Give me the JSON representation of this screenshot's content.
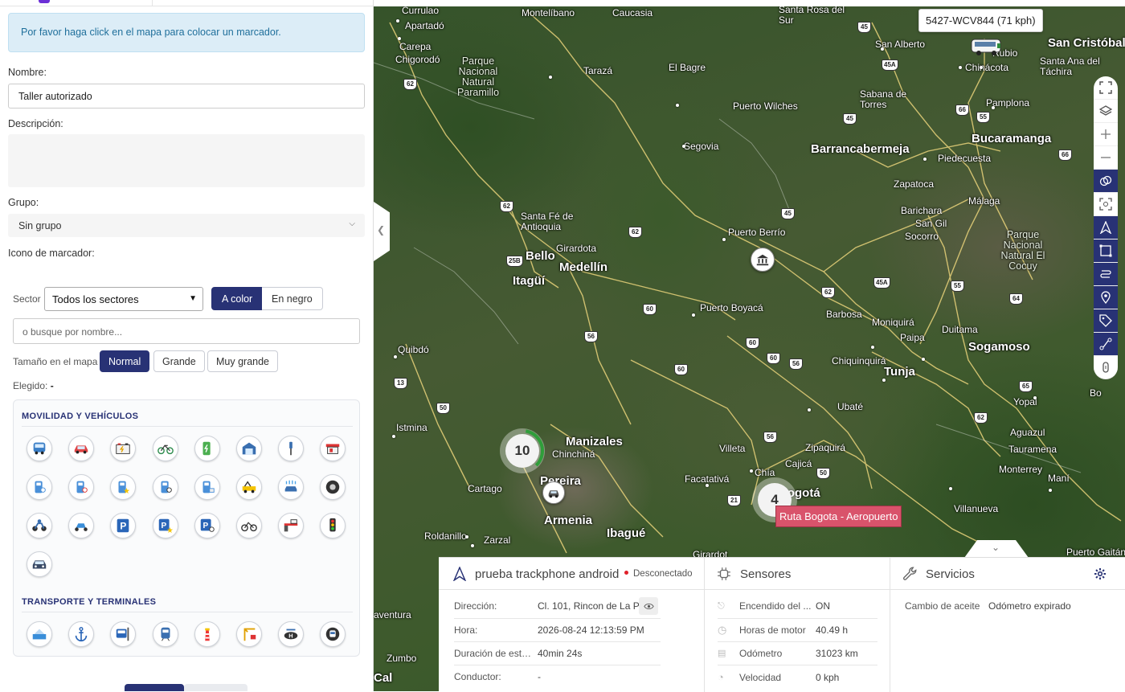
{
  "form": {
    "alert": "Por favor haga click en el mapa para colocar un marcador.",
    "name_label": "Nombre:",
    "name_value": "Taller autorizado",
    "desc_label": "Descripción:",
    "group_label": "Grupo:",
    "group_value": "Sin grupo",
    "icon_label": "Icono de marcador:",
    "sector_label": "Sector",
    "sector_value": "Todos los sectores",
    "color_btn": "A color",
    "black_btn": "En negro",
    "search_placeholder": "o busque por nombre...",
    "size_label": "Tamaño en el mapa",
    "size_options": [
      "Normal",
      "Grande",
      "Muy grande"
    ],
    "chosen_label": "Elegido:",
    "chosen_value": "-"
  },
  "icon_categories": [
    {
      "title": "MOVILIDAD Y VEHÍCULOS",
      "icons": [
        "bus-icon",
        "car-icon",
        "battery-icon",
        "bicycle-icon",
        "ev-charger-icon",
        "garage-icon",
        "screwdriver-icon",
        "gas-station-icon",
        "fuel-pump-icon",
        "fuel-pump-2-icon",
        "fuel-pump-star-icon",
        "fuel-pump-3-icon",
        "fuel-pump-4-icon",
        "tow-truck-icon",
        "car-wash-icon",
        "tire-icon",
        "motorcycle-icon",
        "scooter-icon",
        "parking-icon",
        "parking-star-icon",
        "parking-search-icon",
        "bicycle-2-icon",
        "toll-barrier-icon",
        "traffic-light-icon",
        "car-front-icon"
      ]
    },
    {
      "title": "TRANSPORTE Y TERMINALES",
      "icons": [
        "airport-icon",
        "anchor-icon",
        "bus-stop-icon",
        "train-icon",
        "lighthouse-icon",
        "port-crane-icon",
        "helipad-icon",
        "metro-icon"
      ]
    }
  ],
  "map": {
    "vehicle_tooltip": "5427-WCV844 (71 kph)",
    "route_tag": "Ruta Bogota - Aeropuerto",
    "clusters": [
      {
        "count": "10"
      },
      {
        "count": "4"
      }
    ],
    "places": [
      {
        "name": "Currulao"
      },
      {
        "name": "Apartadó"
      },
      {
        "name": "Carepa"
      },
      {
        "name": "Chigorodó"
      },
      {
        "name": "Montelíbano"
      },
      {
        "name": "Caucasia"
      },
      {
        "name": "Santa Rosa del Sur"
      },
      {
        "name": "San Alberto"
      },
      {
        "name": "San Cristóbal"
      },
      {
        "name": "Santa Ana del Táchira"
      },
      {
        "name": "Chinácota"
      },
      {
        "name": "Rubio"
      },
      {
        "name": "Tarazá"
      },
      {
        "name": "El Bagre"
      },
      {
        "name": "Puerto Wilches"
      },
      {
        "name": "Sabana de Torres"
      },
      {
        "name": "Pamplona"
      },
      {
        "name": "Bucaramanga"
      },
      {
        "name": "Piedecuesta"
      },
      {
        "name": "Segovia"
      },
      {
        "name": "Barrancabermeja"
      },
      {
        "name": "Zapatoca"
      },
      {
        "name": "Málaga"
      },
      {
        "name": "Barichara"
      },
      {
        "name": "San Gil"
      },
      {
        "name": "Socorro"
      },
      {
        "name": "Santa Fé de Antioquia"
      },
      {
        "name": "Girardota"
      },
      {
        "name": "Bello"
      },
      {
        "name": "Medellín"
      },
      {
        "name": "Itagüí"
      },
      {
        "name": "Puerto Berrío"
      },
      {
        "name": "Puerto Boyacá"
      },
      {
        "name": "Barbosa"
      },
      {
        "name": "Moniquirá"
      },
      {
        "name": "Paipa"
      },
      {
        "name": "Duitama"
      },
      {
        "name": "Sogamoso"
      },
      {
        "name": "Quibdó"
      },
      {
        "name": "Chiquinquirá"
      },
      {
        "name": "Tunja"
      },
      {
        "name": "Ubaté"
      },
      {
        "name": "Yopal"
      },
      {
        "name": "Istmina"
      },
      {
        "name": "Manizales"
      },
      {
        "name": "Chinchiná"
      },
      {
        "name": "Villeta"
      },
      {
        "name": "Zipaquirá"
      },
      {
        "name": "Cajicá"
      },
      {
        "name": "Chía"
      },
      {
        "name": "Aguazul"
      },
      {
        "name": "Tauramena"
      },
      {
        "name": "Monterrey"
      },
      {
        "name": "Pereira"
      },
      {
        "name": "Cartago"
      },
      {
        "name": "Facatativá"
      },
      {
        "name": "Bogotá"
      },
      {
        "name": "Villanueva"
      },
      {
        "name": "Maní"
      },
      {
        "name": "Armenia"
      },
      {
        "name": "Ibagué"
      },
      {
        "name": "Roldanillo"
      },
      {
        "name": "Zarzal"
      },
      {
        "name": "Girardot"
      },
      {
        "name": "Puerto Gaitán"
      },
      {
        "name": "aventura"
      },
      {
        "name": "Zumbo"
      },
      {
        "name": "Cal"
      },
      {
        "name": "Bo"
      }
    ],
    "parks": [
      {
        "name": "Parque Nacional Natural Paramillo"
      },
      {
        "name": "Parque Nacional Natural El Cocuy"
      }
    ],
    "route_shields": [
      "62",
      "45",
      "45A",
      "45",
      "66",
      "55",
      "66",
      "62",
      "62",
      "45",
      "25B",
      "60",
      "56",
      "60",
      "62",
      "45A",
      "55",
      "64",
      "60",
      "56",
      "60",
      "13",
      "50",
      "56",
      "50",
      "21",
      "62",
      "65"
    ]
  },
  "info": {
    "device": {
      "name": "prueba trackphone android",
      "status": "Desconectado",
      "status_color": "#e0202a",
      "rows": [
        {
          "k": "Dirección:",
          "v": "Cl. 101, Rincon de La P..."
        },
        {
          "k": "Hora:",
          "v": "2026-08-24 12:13:59 PM"
        },
        {
          "k": "Duración de esta...",
          "v": "40min 24s"
        },
        {
          "k": "Conductor:",
          "v": "-"
        }
      ]
    },
    "sensors": {
      "title": "Sensores",
      "rows": [
        {
          "k": "Encendido del ...",
          "v": "ON"
        },
        {
          "k": "Horas de motor",
          "v": "40.49 h"
        },
        {
          "k": "Odómetro",
          "v": "31023 km"
        },
        {
          "k": "Velocidad",
          "v": "0 kph"
        }
      ]
    },
    "services": {
      "title": "Servicios",
      "rows": [
        {
          "k": "Cambio de aceite",
          "v": "Odómetro expirado"
        }
      ]
    }
  },
  "colors": {
    "primary": "#283275",
    "alert_bg": "#dcedf7",
    "route_tag": "#d9536b"
  }
}
